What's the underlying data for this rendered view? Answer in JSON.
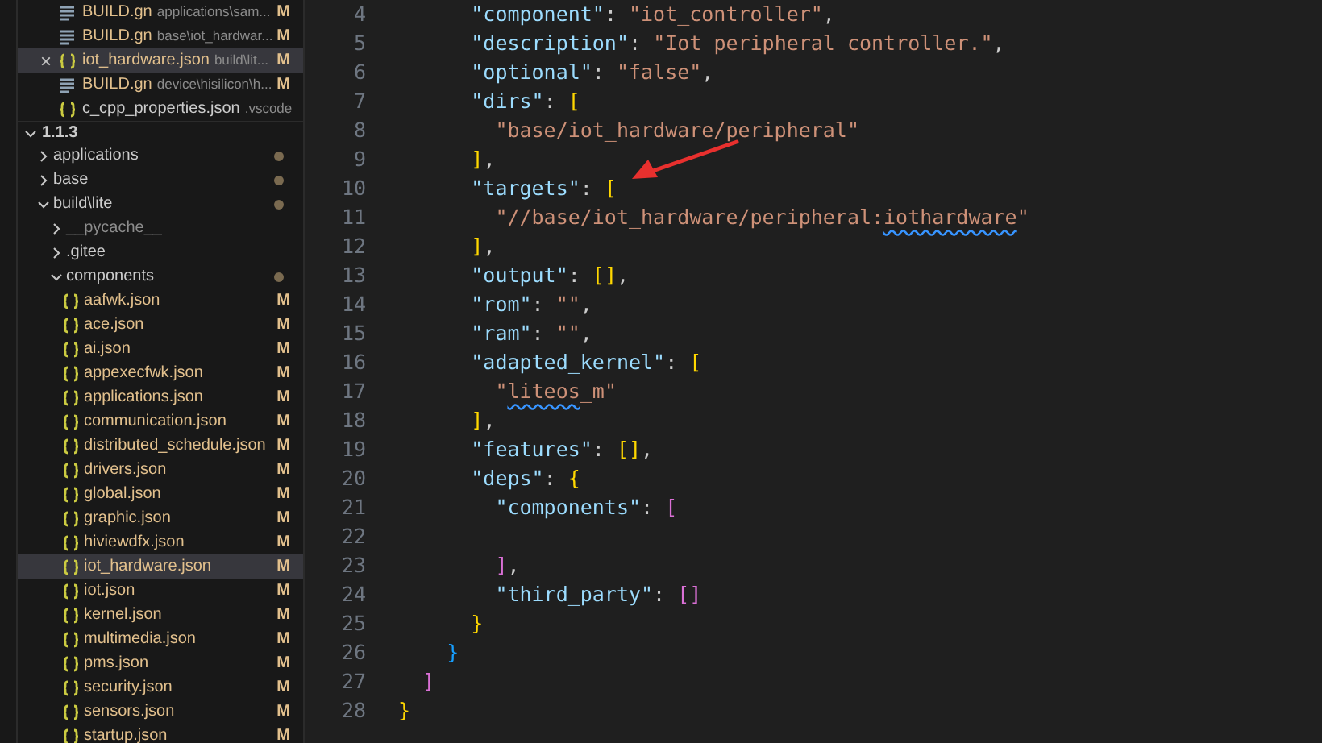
{
  "open_editors": [
    {
      "kind": "gn",
      "name": "BUILD.gn",
      "path": "applications\\sam...",
      "status": "M",
      "selected": false
    },
    {
      "kind": "gn",
      "name": "BUILD.gn",
      "path": "base\\iot_hardwar...",
      "status": "M",
      "selected": false
    },
    {
      "kind": "json",
      "name": "iot_hardware.json",
      "path": "build\\lit...",
      "status": "M",
      "selected": true,
      "close": "×"
    },
    {
      "kind": "gn",
      "name": "BUILD.gn",
      "path": "device\\hisilicon\\h...",
      "status": "M",
      "selected": false
    },
    {
      "kind": "json",
      "name": "c_cpp_properties.json",
      "path": ".vscode",
      "selected": false
    }
  ],
  "explorer": {
    "title": "1.1.3",
    "expanded": true,
    "items": [
      {
        "kind": "folder",
        "name": "applications",
        "expanded": false,
        "modified_dot": true
      },
      {
        "kind": "folder",
        "name": "base",
        "expanded": false,
        "modified_dot": true
      },
      {
        "kind": "folder",
        "name": "build\\lite",
        "expanded": true,
        "modified_dot": true,
        "children": [
          {
            "kind": "folder",
            "name": "__pycache__",
            "expanded": false,
            "ignored": true
          },
          {
            "kind": "folder",
            "name": ".gitee",
            "expanded": false
          },
          {
            "kind": "folder",
            "name": "components",
            "expanded": true,
            "modified_dot": true,
            "children": [
              {
                "kind": "file",
                "name": "aafwk.json",
                "status": "M",
                "selected": false
              },
              {
                "kind": "file",
                "name": "ace.json",
                "status": "M",
                "selected": false
              },
              {
                "kind": "file",
                "name": "ai.json",
                "status": "M",
                "selected": false
              },
              {
                "kind": "file",
                "name": "appexecfwk.json",
                "status": "M",
                "selected": false
              },
              {
                "kind": "file",
                "name": "applications.json",
                "status": "M",
                "selected": false
              },
              {
                "kind": "file",
                "name": "communication.json",
                "status": "M",
                "selected": false
              },
              {
                "kind": "file",
                "name": "distributed_schedule.json",
                "status": "M",
                "selected": false
              },
              {
                "kind": "file",
                "name": "drivers.json",
                "status": "M",
                "selected": false
              },
              {
                "kind": "file",
                "name": "global.json",
                "status": "M",
                "selected": false
              },
              {
                "kind": "file",
                "name": "graphic.json",
                "status": "M",
                "selected": false
              },
              {
                "kind": "file",
                "name": "hiviewdfx.json",
                "status": "M",
                "selected": false
              },
              {
                "kind": "file",
                "name": "iot_hardware.json",
                "status": "M",
                "selected": true
              },
              {
                "kind": "file",
                "name": "iot.json",
                "status": "M",
                "selected": false
              },
              {
                "kind": "file",
                "name": "kernel.json",
                "status": "M",
                "selected": false
              },
              {
                "kind": "file",
                "name": "multimedia.json",
                "status": "M",
                "selected": false
              },
              {
                "kind": "file",
                "name": "pms.json",
                "status": "M",
                "selected": false
              },
              {
                "kind": "file",
                "name": "security.json",
                "status": "M",
                "selected": false
              },
              {
                "kind": "file",
                "name": "sensors.json",
                "status": "M",
                "selected": false
              },
              {
                "kind": "file",
                "name": "startup.json",
                "status": "M",
                "selected": false
              }
            ]
          }
        ]
      }
    ]
  },
  "editor": {
    "lines": [
      {
        "number": "4",
        "tokens": [
          {
            "text": "      \"component\"",
            "kind": "key"
          },
          {
            "text": ": ",
            "kind": "punct"
          },
          {
            "text": "\"iot_controller\"",
            "kind": "string"
          },
          {
            "text": ",",
            "kind": "punct"
          }
        ]
      },
      {
        "number": "5",
        "tokens": [
          {
            "text": "      \"description\"",
            "kind": "key"
          },
          {
            "text": ": ",
            "kind": "punct"
          },
          {
            "text": "\"Iot peripheral controller.\"",
            "kind": "string"
          },
          {
            "text": ",",
            "kind": "punct"
          }
        ]
      },
      {
        "number": "6",
        "tokens": [
          {
            "text": "      \"optional\"",
            "kind": "key"
          },
          {
            "text": ": ",
            "kind": "punct"
          },
          {
            "text": "\"false\"",
            "kind": "string"
          },
          {
            "text": ",",
            "kind": "punct"
          }
        ]
      },
      {
        "number": "7",
        "tokens": [
          {
            "text": "      \"dirs\"",
            "kind": "key"
          },
          {
            "text": ": ",
            "kind": "punct"
          },
          {
            "text": "[",
            "kind": "bracket1"
          }
        ]
      },
      {
        "number": "8",
        "tokens": [
          {
            "text": "        \"base/iot_hardware/peripheral\"",
            "kind": "string"
          }
        ]
      },
      {
        "number": "9",
        "tokens": [
          {
            "text": "      ]",
            "kind": "bracket1"
          },
          {
            "text": ",",
            "kind": "punct"
          }
        ]
      },
      {
        "number": "10",
        "tokens": [
          {
            "text": "      \"targets\"",
            "kind": "key"
          },
          {
            "text": ": ",
            "kind": "punct"
          },
          {
            "text": "[",
            "kind": "bracket1"
          }
        ]
      },
      {
        "number": "11",
        "tokens": [
          {
            "text": "        \"//base/iot_hardware/peripheral:",
            "kind": "string"
          },
          {
            "text": "iothardware",
            "kind": "string",
            "squiggle": true
          },
          {
            "text": "\"",
            "kind": "string"
          }
        ]
      },
      {
        "number": "12",
        "tokens": [
          {
            "text": "      ]",
            "kind": "bracket1"
          },
          {
            "text": ",",
            "kind": "punct"
          }
        ]
      },
      {
        "number": "13",
        "tokens": [
          {
            "text": "      \"output\"",
            "kind": "key"
          },
          {
            "text": ": ",
            "kind": "punct"
          },
          {
            "text": "[]",
            "kind": "bracket1"
          },
          {
            "text": ",",
            "kind": "punct"
          }
        ]
      },
      {
        "number": "14",
        "tokens": [
          {
            "text": "      \"rom\"",
            "kind": "key"
          },
          {
            "text": ": ",
            "kind": "punct"
          },
          {
            "text": "\"\"",
            "kind": "string"
          },
          {
            "text": ",",
            "kind": "punct"
          }
        ]
      },
      {
        "number": "15",
        "tokens": [
          {
            "text": "      \"ram\"",
            "kind": "key"
          },
          {
            "text": ": ",
            "kind": "punct"
          },
          {
            "text": "\"\"",
            "kind": "string"
          },
          {
            "text": ",",
            "kind": "punct"
          }
        ]
      },
      {
        "number": "16",
        "tokens": [
          {
            "text": "      \"adapted_kernel\"",
            "kind": "key"
          },
          {
            "text": ": ",
            "kind": "punct"
          },
          {
            "text": "[",
            "kind": "bracket1"
          }
        ]
      },
      {
        "number": "17",
        "tokens": [
          {
            "text": "        \"",
            "kind": "string"
          },
          {
            "text": "liteos",
            "kind": "string",
            "squiggle": true
          },
          {
            "text": "_m\"",
            "kind": "string"
          }
        ]
      },
      {
        "number": "18",
        "tokens": [
          {
            "text": "      ]",
            "kind": "bracket1"
          },
          {
            "text": ",",
            "kind": "punct"
          }
        ]
      },
      {
        "number": "19",
        "tokens": [
          {
            "text": "      \"features\"",
            "kind": "key"
          },
          {
            "text": ": ",
            "kind": "punct"
          },
          {
            "text": "[]",
            "kind": "bracket1"
          },
          {
            "text": ",",
            "kind": "punct"
          }
        ]
      },
      {
        "number": "20",
        "tokens": [
          {
            "text": "      \"deps\"",
            "kind": "key"
          },
          {
            "text": ": ",
            "kind": "punct"
          },
          {
            "text": "{",
            "kind": "bracket1"
          }
        ]
      },
      {
        "number": "21",
        "tokens": [
          {
            "text": "        \"components\"",
            "kind": "key"
          },
          {
            "text": ": ",
            "kind": "punct"
          },
          {
            "text": "[",
            "kind": "bracket2"
          }
        ]
      },
      {
        "number": "22"
      },
      {
        "number": "23",
        "tokens": [
          {
            "text": "        ]",
            "kind": "bracket2"
          },
          {
            "text": ",",
            "kind": "punct"
          }
        ]
      },
      {
        "number": "24",
        "tokens": [
          {
            "text": "        \"third_party\"",
            "kind": "key"
          },
          {
            "text": ": ",
            "kind": "punct"
          },
          {
            "text": "[]",
            "kind": "bracket2"
          }
        ]
      },
      {
        "number": "25",
        "tokens": [
          {
            "text": "      }",
            "kind": "bracket1"
          }
        ]
      },
      {
        "number": "26",
        "tokens": [
          {
            "text": "    }",
            "kind": "bracket3"
          }
        ]
      },
      {
        "number": "27",
        "tokens": [
          {
            "text": "  ]",
            "kind": "bracket2"
          }
        ]
      },
      {
        "number": "28",
        "tokens": [
          {
            "text": "}",
            "kind": "bracket1"
          }
        ]
      }
    ]
  }
}
